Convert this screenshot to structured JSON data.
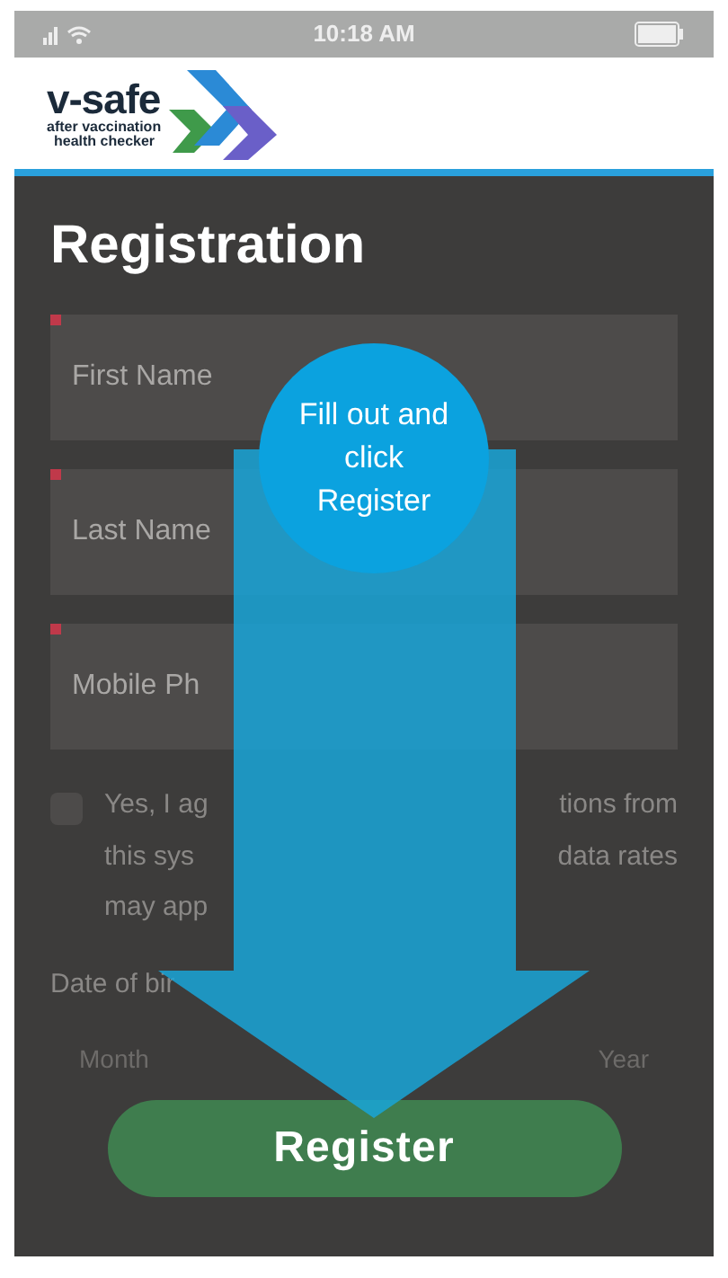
{
  "status_bar": {
    "time": "10:18 AM"
  },
  "logo": {
    "name": "v-safe",
    "tagline_1": "after vaccination",
    "tagline_2": "health checker"
  },
  "title": "Registration",
  "fields": [
    {
      "placeholder": "First Name",
      "required": true
    },
    {
      "placeholder": "Last Name",
      "required": true
    },
    {
      "placeholder": "Mobile Ph",
      "required": true
    }
  ],
  "agreement": {
    "checked": false,
    "lines": [
      {
        "left": "Yes, I ag",
        "right": "tions from"
      },
      {
        "left": "this sys",
        "right": "data rates"
      },
      {
        "left": "may app"
      }
    ]
  },
  "date_of_birth": {
    "label": "Date of bir",
    "parts": [
      "Month",
      "Year"
    ]
  },
  "callout": {
    "text": "Fill out and click Register"
  },
  "register_button": "Register"
}
